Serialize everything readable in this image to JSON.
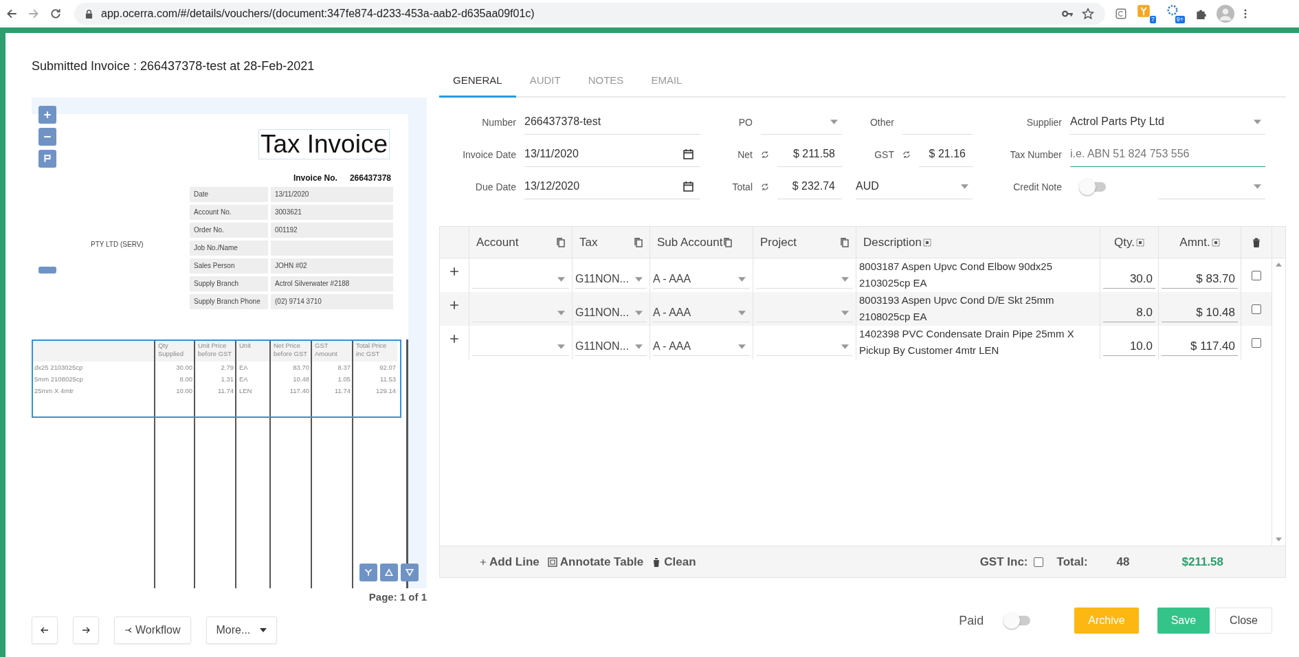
{
  "browser": {
    "url": "app.ocerra.com/#/details/vouchers/(document:347fe874-d233-453a-aab2-d635aa09f01c)",
    "badges": [
      "7",
      "9+"
    ]
  },
  "title": "Submitted Invoice : 266437378-test at 28-Feb-2021",
  "document": {
    "heading": "Tax Invoice",
    "invoice_no_label": "Invoice No.",
    "invoice_no": "266437378",
    "details": [
      {
        "label": "Date",
        "value": "13/11/2020"
      },
      {
        "label": "Account No.",
        "value": "3003621"
      },
      {
        "label": "Order No.",
        "value": "001192"
      },
      {
        "label": "Job No./Name"
      },
      {
        "label": "Sales Person",
        "value": "JOHN #02"
      },
      {
        "label": "Supply Branch",
        "value": "Actrol Silverwater #2188"
      },
      {
        "label": "Supply Branch Phone",
        "value": "(02) 9714 3710"
      }
    ],
    "customer": "PTY LTD (SERV)",
    "columns": [
      "Qty Supplied",
      "Unit Price before GST",
      "Unit",
      "Net Price before GST",
      "GST Amount",
      "Total Price inc GST"
    ],
    "rows": [
      {
        "column_1": "dx25 2103025cp",
        "cells": [
          "30.00",
          "2.79",
          "EA",
          "83.70",
          "8.37",
          "92.07"
        ]
      },
      {
        "column_1": "5mm 2108025cp",
        "cells": [
          "8.00",
          "1.31",
          "EA",
          "10.48",
          "1.05",
          "11.53"
        ]
      },
      {
        "column_1": "25mm X 4mtr",
        "cells": [
          "10.00",
          "11.74",
          "LEN",
          "117.40",
          "11.74",
          "129.14"
        ]
      }
    ],
    "page": "Page: 1 of 1"
  },
  "tabs": [
    {
      "label": "GENERAL",
      "selected": true
    },
    {
      "label": "AUDIT",
      "selected": false
    },
    {
      "label": "NOTES",
      "selected": false
    },
    {
      "label": "EMAIL",
      "selected": false
    }
  ],
  "fields": [
    {
      "label": "Number",
      "kind": "text",
      "value": "266437378-test"
    },
    {
      "label": "PO",
      "kind": "select"
    },
    {
      "label": "Other",
      "kind": "text"
    },
    {
      "label": "Supplier",
      "kind": "select",
      "value": "Actrol Parts Pty Ltd"
    },
    {
      "label": "Invoice Date",
      "kind": "date",
      "value": "13/11/2020"
    },
    {
      "label": "Net",
      "kind": "amount",
      "value": "$ 211.58"
    },
    {
      "label": "GST",
      "kind": "amount",
      "value": "$ 21.16"
    },
    {
      "label": "Tax Number",
      "kind": "input",
      "placeholder": "i.e. ABN 51 824 753 556",
      "focused": true
    },
    {
      "label": "Due Date",
      "kind": "date",
      "value": "13/12/2020"
    },
    {
      "label": "Total",
      "kind": "amount",
      "value": "$ 232.74"
    },
    {
      "kind": "select",
      "value": "AUD"
    },
    {
      "label": "Credit Note",
      "kind": "toggle",
      "on": false
    }
  ],
  "table": {
    "columns": [
      {
        "label": "Account",
        "kind": "copy"
      },
      {
        "label": "Tax",
        "kind": "copy"
      },
      {
        "label": "Sub Account",
        "kind": "copy"
      },
      {
        "label": "Project",
        "kind": "copy"
      },
      {
        "label": "Description",
        "kind": "select"
      },
      {
        "label": "Qty.",
        "kind": "select"
      },
      {
        "label": "Amnt.",
        "kind": "select"
      },
      {
        "kind": "delete"
      }
    ],
    "rows": [
      {
        "tax": "G11NON...",
        "sub_account": "A - AAA",
        "description": "8003187 Aspen Upvc Cond Elbow 90dx25 2103025cp EA",
        "qty": "30.0",
        "amount": "$ 83.70",
        "checked": false
      },
      {
        "tax": "G11NON...",
        "sub_account": "A - AAA",
        "description": "8003193 Aspen Upvc Cond D/E Skt 25mm 2108025cp EA",
        "qty": "8.0",
        "amount": "$ 10.48",
        "checked": false
      },
      {
        "tax": "G11NON...",
        "sub_account": "A - AAA",
        "description": "1402398 PVC Condensate Drain Pipe 25mm X Pickup By Customer 4mtr LEN",
        "qty": "10.0",
        "amount": "$ 117.40",
        "checked": false
      }
    ],
    "footer": {
      "add_line": "Add Line",
      "annotate": "Annotate Table",
      "clean": "Clean",
      "gst_inc_label": "GST Inc:",
      "gst_inc_checked": false,
      "total_label": "Total:",
      "count": "48",
      "total": "$211.58"
    }
  },
  "bottom": {
    "workflow": "Workflow",
    "more": "More...",
    "paid_label": "Paid",
    "paid_on": false,
    "archive": "Archive",
    "save": "Save",
    "close": "Close"
  }
}
